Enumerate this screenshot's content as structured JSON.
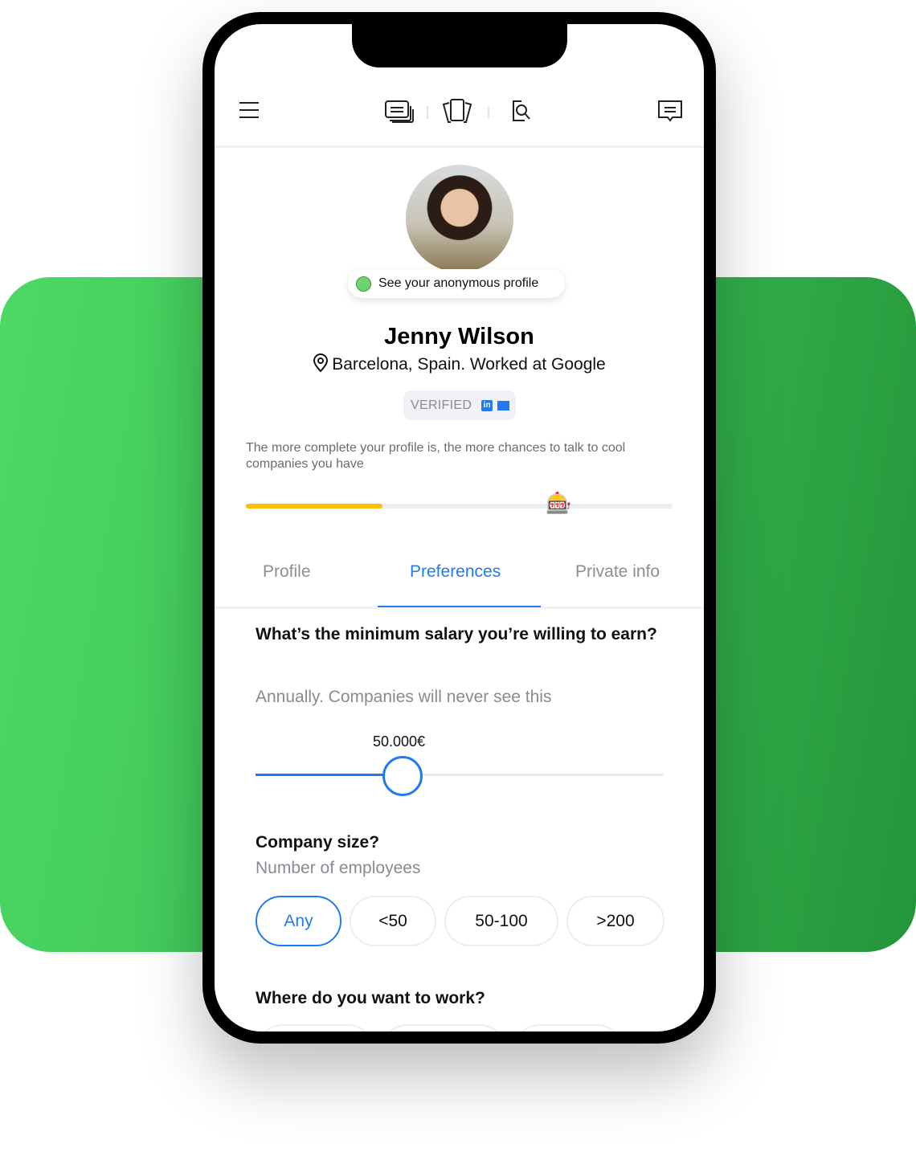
{
  "nav": {
    "menu": "menu-icon",
    "icons": [
      "cards-stack-icon",
      "swipe-cards-icon",
      "search-document-icon"
    ],
    "messages": "chat-icon"
  },
  "profile": {
    "anonymous_link": "See your anonymous profile",
    "name": "Jenny Wilson",
    "location": "Barcelona, Spain. Worked at Google",
    "verified": "VERIFIED",
    "completion_hint": "The more complete your profile is, the more chances to talk to cool companies you have",
    "completion_progress": 0.32
  },
  "tabs": [
    {
      "label": "Profile"
    },
    {
      "label": "Preferences",
      "active": true
    },
    {
      "label": "Private info"
    }
  ],
  "preferences": {
    "salary": {
      "question": "What’s the minimum salary you’re willing to earn?",
      "subtitle": "Annually. Companies will never see this",
      "value": "50.000€",
      "slider_fraction": 0.36
    },
    "company_size": {
      "question": "Company size?",
      "subtitle": "Number of employees",
      "options": [
        "Any",
        "<50",
        "50-100",
        ">200"
      ],
      "selected": "Any"
    },
    "work_location": {
      "question": "Where do you want to work?"
    }
  },
  "colors": {
    "accent": "#1f7bf2",
    "progress": "#f9c102",
    "background_panel": "#3cbf55"
  }
}
